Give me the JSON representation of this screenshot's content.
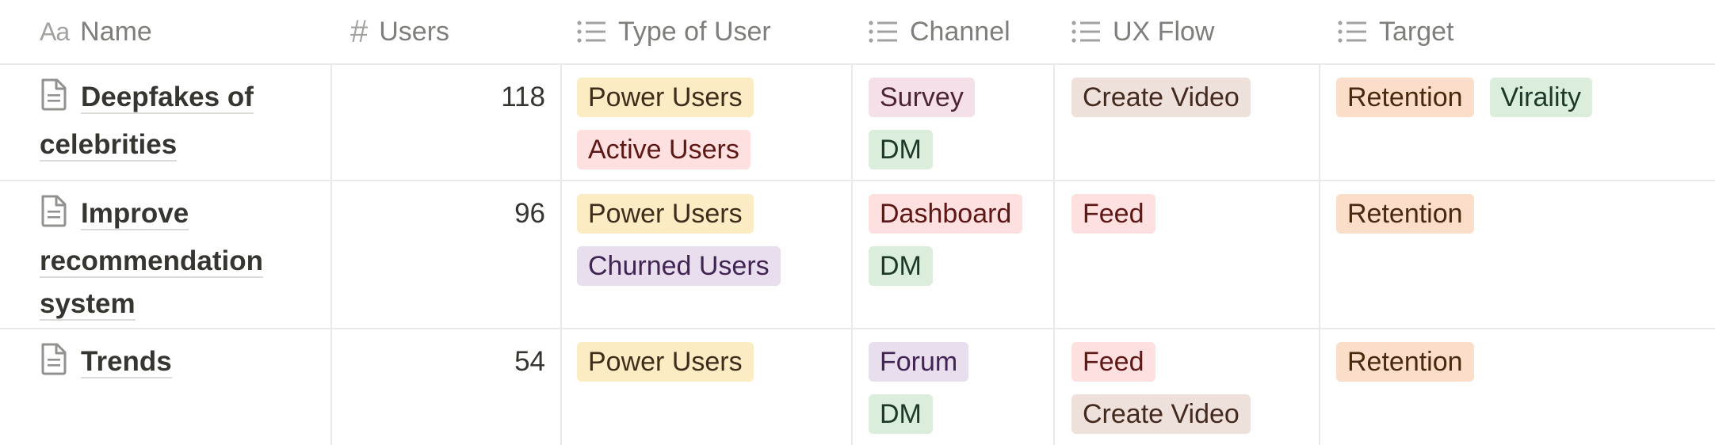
{
  "columns": [
    {
      "label": "Name",
      "icon": "title-property-icon"
    },
    {
      "label": "Users",
      "icon": "number-property-icon"
    },
    {
      "label": "Type of User",
      "icon": "multi-select-property-icon"
    },
    {
      "label": "Channel",
      "icon": "multi-select-property-icon"
    },
    {
      "label": "UX Flow",
      "icon": "multi-select-property-icon"
    },
    {
      "label": "Target",
      "icon": "multi-select-property-icon"
    }
  ],
  "header_icon_aa": "Aa",
  "header_icon_hash": "#",
  "rows": [
    {
      "name_line1": "Deepfakes of",
      "name_line2": "celebrities",
      "users": "118",
      "type_of_user": [
        "Power Users",
        "Active Users"
      ],
      "channel": [
        "Survey",
        "DM"
      ],
      "ux_flow": [
        "Create Video"
      ],
      "target": [
        "Retention",
        "Virality"
      ]
    },
    {
      "name_line1": "Improve",
      "name_line2": "recommendation",
      "name_line3": "system",
      "users": "96",
      "type_of_user": [
        "Power Users",
        "Churned Users"
      ],
      "channel": [
        "Dashboard",
        "DM"
      ],
      "ux_flow": [
        "Feed"
      ],
      "target": [
        "Retention"
      ]
    },
    {
      "name_line1": "Trends",
      "users": "54",
      "type_of_user": [
        "Power Users"
      ],
      "channel": [
        "Forum",
        "DM"
      ],
      "ux_flow": [
        "Feed",
        "Create Video"
      ],
      "target": [
        "Retention"
      ]
    }
  ],
  "tag_colors": {
    "yellow": "#fbecc4",
    "red": "#fde0df",
    "purple": "#e8deee",
    "pink": "#f5e0e9",
    "green": "#dbeddb",
    "brown": "#eee0da",
    "orange": "#fadec9"
  }
}
